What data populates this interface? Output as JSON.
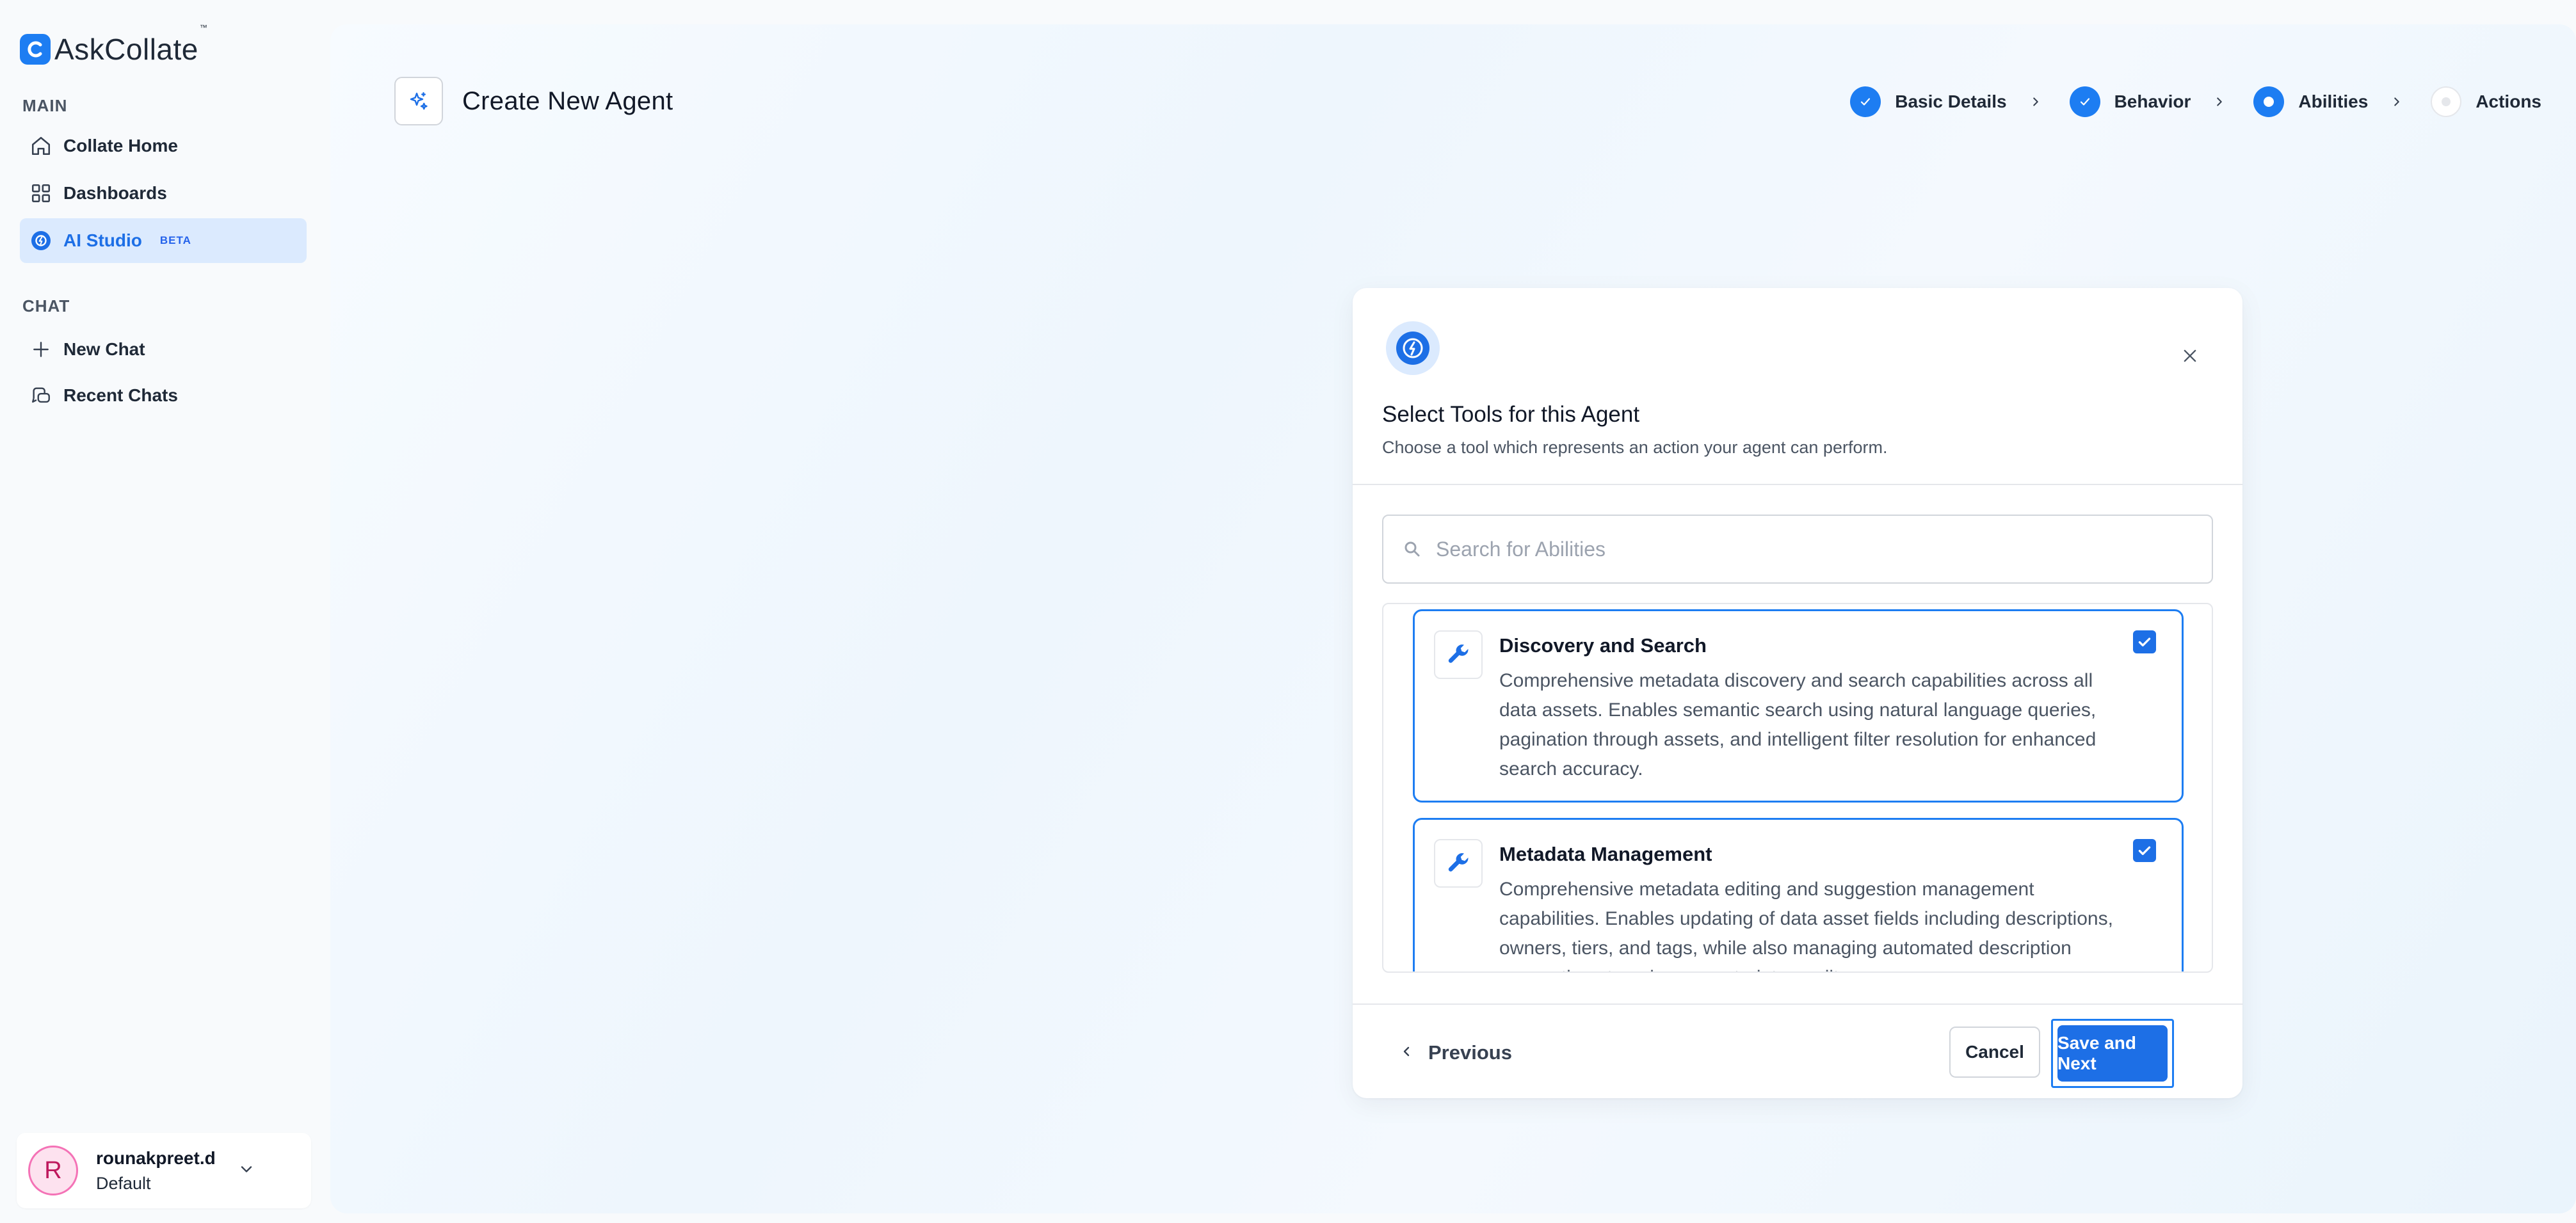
{
  "app": {
    "name": "AskCollate",
    "trademark": "™"
  },
  "sidebar": {
    "main_label": "MAIN",
    "main_items": [
      {
        "label": "Collate Home",
        "icon": "home-icon"
      },
      {
        "label": "Dashboards",
        "icon": "grid-icon"
      },
      {
        "label": "AI Studio",
        "icon": "ai-studio-icon",
        "badge": "BETA",
        "active": true
      }
    ],
    "chat_label": "CHAT",
    "chat_items": [
      {
        "label": "New Chat",
        "icon": "plus-icon"
      },
      {
        "label": "Recent Chats",
        "icon": "chat-bubbles-icon"
      }
    ],
    "user": {
      "initial": "R",
      "name": "rounakpreet.d",
      "role": "Default"
    }
  },
  "header": {
    "title": "Create New Agent"
  },
  "stepper": {
    "steps": [
      {
        "label": "Basic Details",
        "state": "done"
      },
      {
        "label": "Behavior",
        "state": "done"
      },
      {
        "label": "Abilities",
        "state": "current"
      },
      {
        "label": "Actions",
        "state": "todo"
      }
    ]
  },
  "modal": {
    "title": "Select Tools for this Agent",
    "subtitle": "Choose a tool which represents an action your agent can perform.",
    "search_placeholder": "Search for Abilities",
    "tools": [
      {
        "name": "Discovery and Search",
        "description": "Comprehensive metadata discovery and search capabilities across all data assets. Enables semantic search using natural language queries, pagination through assets, and intelligent filter resolution for enhanced search accuracy.",
        "checked": true
      },
      {
        "name": "Metadata Management",
        "description": "Comprehensive metadata editing and suggestion management capabilities. Enables updating of data asset fields including descriptions, owners, tiers, and tags, while also managing automated description suggestions to enhance metadata quality.",
        "checked": true
      }
    ],
    "previous_label": "Previous",
    "cancel_label": "Cancel",
    "save_label": "Save and Next"
  },
  "colors": {
    "accent": "#1d7df2",
    "active_bg": "#dbeafe",
    "avatar_border": "#f472b6"
  }
}
